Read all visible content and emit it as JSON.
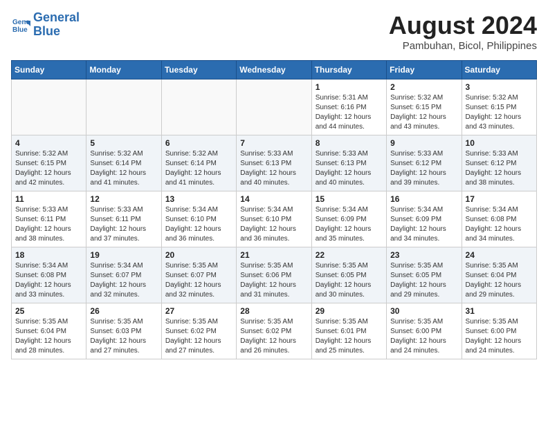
{
  "logo": {
    "line1": "General",
    "line2": "Blue"
  },
  "title": "August 2024",
  "location": "Pambuhan, Bicol, Philippines",
  "weekdays": [
    "Sunday",
    "Monday",
    "Tuesday",
    "Wednesday",
    "Thursday",
    "Friday",
    "Saturday"
  ],
  "weeks": [
    [
      {
        "day": "",
        "info": ""
      },
      {
        "day": "",
        "info": ""
      },
      {
        "day": "",
        "info": ""
      },
      {
        "day": "",
        "info": ""
      },
      {
        "day": "1",
        "info": "Sunrise: 5:31 AM\nSunset: 6:16 PM\nDaylight: 12 hours\nand 44 minutes."
      },
      {
        "day": "2",
        "info": "Sunrise: 5:32 AM\nSunset: 6:15 PM\nDaylight: 12 hours\nand 43 minutes."
      },
      {
        "day": "3",
        "info": "Sunrise: 5:32 AM\nSunset: 6:15 PM\nDaylight: 12 hours\nand 43 minutes."
      }
    ],
    [
      {
        "day": "4",
        "info": "Sunrise: 5:32 AM\nSunset: 6:15 PM\nDaylight: 12 hours\nand 42 minutes."
      },
      {
        "day": "5",
        "info": "Sunrise: 5:32 AM\nSunset: 6:14 PM\nDaylight: 12 hours\nand 41 minutes."
      },
      {
        "day": "6",
        "info": "Sunrise: 5:32 AM\nSunset: 6:14 PM\nDaylight: 12 hours\nand 41 minutes."
      },
      {
        "day": "7",
        "info": "Sunrise: 5:33 AM\nSunset: 6:13 PM\nDaylight: 12 hours\nand 40 minutes."
      },
      {
        "day": "8",
        "info": "Sunrise: 5:33 AM\nSunset: 6:13 PM\nDaylight: 12 hours\nand 40 minutes."
      },
      {
        "day": "9",
        "info": "Sunrise: 5:33 AM\nSunset: 6:12 PM\nDaylight: 12 hours\nand 39 minutes."
      },
      {
        "day": "10",
        "info": "Sunrise: 5:33 AM\nSunset: 6:12 PM\nDaylight: 12 hours\nand 38 minutes."
      }
    ],
    [
      {
        "day": "11",
        "info": "Sunrise: 5:33 AM\nSunset: 6:11 PM\nDaylight: 12 hours\nand 38 minutes."
      },
      {
        "day": "12",
        "info": "Sunrise: 5:33 AM\nSunset: 6:11 PM\nDaylight: 12 hours\nand 37 minutes."
      },
      {
        "day": "13",
        "info": "Sunrise: 5:34 AM\nSunset: 6:10 PM\nDaylight: 12 hours\nand 36 minutes."
      },
      {
        "day": "14",
        "info": "Sunrise: 5:34 AM\nSunset: 6:10 PM\nDaylight: 12 hours\nand 36 minutes."
      },
      {
        "day": "15",
        "info": "Sunrise: 5:34 AM\nSunset: 6:09 PM\nDaylight: 12 hours\nand 35 minutes."
      },
      {
        "day": "16",
        "info": "Sunrise: 5:34 AM\nSunset: 6:09 PM\nDaylight: 12 hours\nand 34 minutes."
      },
      {
        "day": "17",
        "info": "Sunrise: 5:34 AM\nSunset: 6:08 PM\nDaylight: 12 hours\nand 34 minutes."
      }
    ],
    [
      {
        "day": "18",
        "info": "Sunrise: 5:34 AM\nSunset: 6:08 PM\nDaylight: 12 hours\nand 33 minutes."
      },
      {
        "day": "19",
        "info": "Sunrise: 5:34 AM\nSunset: 6:07 PM\nDaylight: 12 hours\nand 32 minutes."
      },
      {
        "day": "20",
        "info": "Sunrise: 5:35 AM\nSunset: 6:07 PM\nDaylight: 12 hours\nand 32 minutes."
      },
      {
        "day": "21",
        "info": "Sunrise: 5:35 AM\nSunset: 6:06 PM\nDaylight: 12 hours\nand 31 minutes."
      },
      {
        "day": "22",
        "info": "Sunrise: 5:35 AM\nSunset: 6:05 PM\nDaylight: 12 hours\nand 30 minutes."
      },
      {
        "day": "23",
        "info": "Sunrise: 5:35 AM\nSunset: 6:05 PM\nDaylight: 12 hours\nand 29 minutes."
      },
      {
        "day": "24",
        "info": "Sunrise: 5:35 AM\nSunset: 6:04 PM\nDaylight: 12 hours\nand 29 minutes."
      }
    ],
    [
      {
        "day": "25",
        "info": "Sunrise: 5:35 AM\nSunset: 6:04 PM\nDaylight: 12 hours\nand 28 minutes."
      },
      {
        "day": "26",
        "info": "Sunrise: 5:35 AM\nSunset: 6:03 PM\nDaylight: 12 hours\nand 27 minutes."
      },
      {
        "day": "27",
        "info": "Sunrise: 5:35 AM\nSunset: 6:02 PM\nDaylight: 12 hours\nand 27 minutes."
      },
      {
        "day": "28",
        "info": "Sunrise: 5:35 AM\nSunset: 6:02 PM\nDaylight: 12 hours\nand 26 minutes."
      },
      {
        "day": "29",
        "info": "Sunrise: 5:35 AM\nSunset: 6:01 PM\nDaylight: 12 hours\nand 25 minutes."
      },
      {
        "day": "30",
        "info": "Sunrise: 5:35 AM\nSunset: 6:00 PM\nDaylight: 12 hours\nand 24 minutes."
      },
      {
        "day": "31",
        "info": "Sunrise: 5:35 AM\nSunset: 6:00 PM\nDaylight: 12 hours\nand 24 minutes."
      }
    ]
  ]
}
